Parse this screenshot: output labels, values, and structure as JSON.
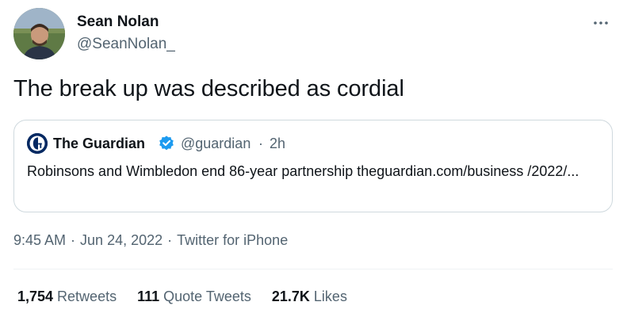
{
  "author": {
    "display_name": "Sean Nolan",
    "handle": "@SeanNolan_"
  },
  "tweet": {
    "text": "The break up was described as cordial"
  },
  "quote": {
    "name": "The Guardian",
    "handle": "@guardian",
    "separator": "·",
    "time": "2h",
    "body": "Robinsons and Wimbledon end 86-year partnership theguardian.com/business /2022/..."
  },
  "meta": {
    "time": "9:45 AM",
    "separator": "·",
    "date": "Jun 24, 2022",
    "source": "Twitter for iPhone"
  },
  "stats": [
    {
      "count": "1,754",
      "label": "Retweets"
    },
    {
      "count": "111",
      "label": "Quote Tweets"
    },
    {
      "count": "21.7K",
      "label": "Likes"
    }
  ],
  "colors": {
    "text_primary": "#0f1419",
    "text_secondary": "#536471",
    "border": "#cfd9de",
    "verified": "#1d9bf0",
    "guardian_brand": "#052962"
  },
  "icons": [
    "more-icon",
    "verified-icon",
    "guardian-logo-icon",
    "avatar-photo"
  ]
}
